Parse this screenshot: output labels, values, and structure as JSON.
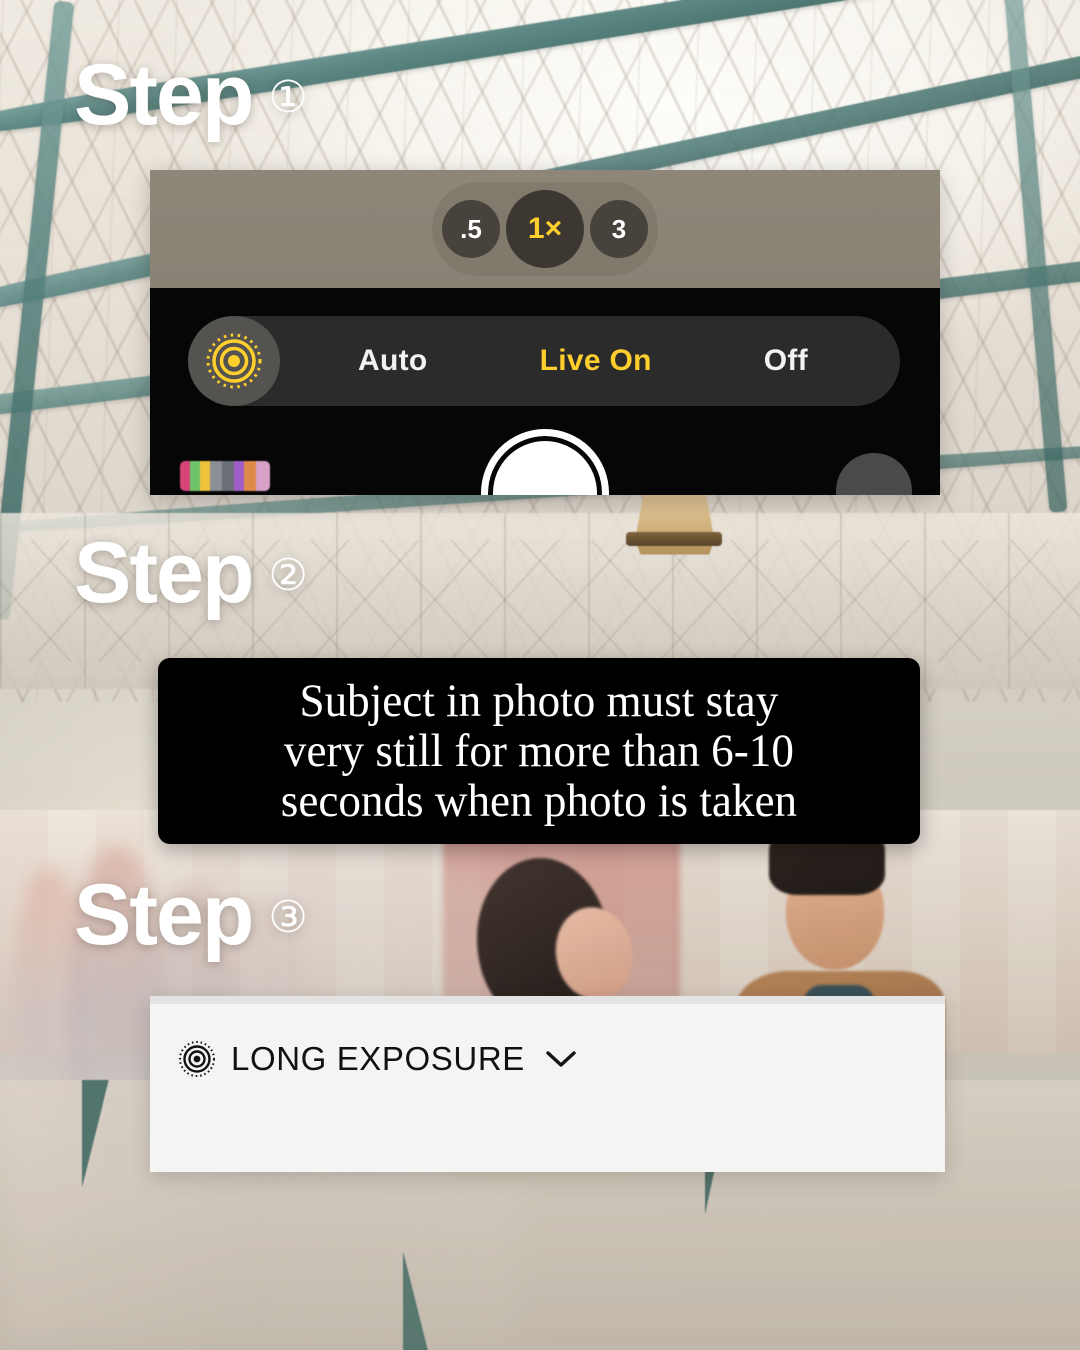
{
  "steps": [
    {
      "word": "Step",
      "number": "①"
    },
    {
      "word": "Step",
      "number": "②"
    },
    {
      "word": "Step",
      "number": "③"
    }
  ],
  "camera": {
    "zoom_control": {
      "name": "zoom-level-selector",
      "options": [
        {
          "label": ".5",
          "selected": false
        },
        {
          "label": "1×",
          "selected": true
        },
        {
          "label": "3",
          "selected": false
        }
      ]
    },
    "live_photo_bar": {
      "icon": "live-photo-icon",
      "options": [
        {
          "label": "Auto",
          "selected": false
        },
        {
          "label": "Live On",
          "selected": true
        },
        {
          "label": "Off",
          "selected": false
        }
      ]
    },
    "shutter_button": "shutter-button",
    "photo_thumbnail": "photo-library-thumbnail",
    "flip_camera_button": "flip-camera-button"
  },
  "caption": {
    "line1": "Subject in photo must stay",
    "line2": "very still for more than 6-10",
    "line3": "seconds when photo is taken"
  },
  "long_exposure_panel": {
    "icon": "live-photo-icon",
    "label": "LONG EXPOSURE",
    "chevron": "chevron-down-icon"
  },
  "colors": {
    "accent_yellow": "#ffcf2e",
    "camera_top_bg": "#8d8679",
    "camera_bottom_bg": "#060606",
    "live_bar_bg": "#2b2b2b",
    "caption_bg": "#000000",
    "panel_bg": "#f4f4f4",
    "step_text": "#ffffff"
  }
}
